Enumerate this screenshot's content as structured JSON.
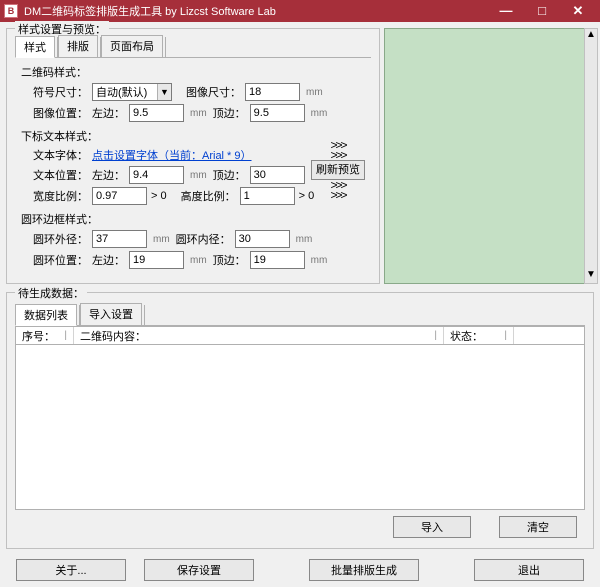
{
  "window": {
    "title": "DM二维码标签排版生成工具   by Lizcst Software Lab",
    "icon_letter": "B",
    "minimize": "—",
    "maximize": "□",
    "close": "✕"
  },
  "style_preview": {
    "legend": "样式设置与预览：",
    "tabs": [
      "样式",
      "排版",
      "页面布局"
    ],
    "qr_section": {
      "title": "二维码样式：",
      "symbol_size_label": "符号尺寸：",
      "symbol_size_value": "自动(默认)",
      "image_size_label": "图像尺寸：",
      "image_size_value": "18",
      "image_pos_label": "图像位置：",
      "left_label": "左边：",
      "left_value": "9.5",
      "top_label": "顶边：",
      "top_value": "9.5",
      "unit": "mm"
    },
    "text_section": {
      "title": "下标文本样式：",
      "font_label": "文本字体：",
      "font_link": "点击设置字体（当前：Arial * 9）",
      "text_pos_label": "文本位置：",
      "left_label": "左边：",
      "left_value": "9.4",
      "top_label": "顶边：",
      "top_value": "30",
      "width_ratio_label": "宽度比例：",
      "width_ratio_value": "0.97",
      "gt0_a": "> 0",
      "height_ratio_label": "高度比例：",
      "height_ratio_value": "1",
      "gt0_b": "> 0",
      "unit": "mm"
    },
    "ring_section": {
      "title": "圆环边框样式：",
      "outer_label": "圆环外径：",
      "outer_value": "37",
      "inner_label": "圆环内径：",
      "inner_value": "30",
      "pos_label": "圆环位置：",
      "left_label": "左边：",
      "left_value": "19",
      "top_label": "顶边：",
      "top_value": "19",
      "unit": "mm"
    },
    "refresh_btn": "刷新预览",
    "chevrons": ">>>"
  },
  "data_group": {
    "legend": "待生成数据：",
    "tabs": [
      "数据列表",
      "导入设置"
    ],
    "columns": {
      "c1": "序号：",
      "c2": "二维码内容：",
      "c3": "状态：",
      "c4": ""
    },
    "import_btn": "导入",
    "clear_btn": "清空"
  },
  "bottom": {
    "about": "关于...",
    "save": "保存设置",
    "batch": "批量排版生成",
    "exit": "退出"
  },
  "scroll": {
    "up": "▲",
    "down": "▼"
  }
}
